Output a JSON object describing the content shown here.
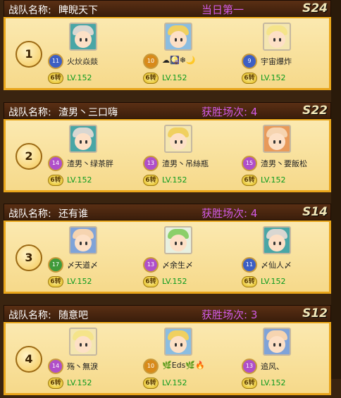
{
  "header_label": "战队名称:",
  "teams": [
    {
      "rank": "1",
      "name": "睥睨天下",
      "stat": "当日第一",
      "server": "S24",
      "members": [
        {
          "name": "火炏焱燚",
          "badge": "11",
          "badge_color": "#3d5fc4",
          "coin": "6转",
          "level": "LV.152",
          "hair": "#d9d7d2",
          "bg": "#49a6a6"
        },
        {
          "name": "☁🎑❄🌙",
          "badge": "10",
          "badge_color": "#d88a1a",
          "coin": "6转",
          "level": "LV.152",
          "hair": "#f0d060",
          "bg": "#8bbde0"
        },
        {
          "name": "宇宙爆炸",
          "badge": "9",
          "badge_color": "#3d5fc4",
          "coin": "6转",
          "level": "LV.152",
          "hair": "#f5e48a",
          "bg": "#f4e6b0"
        }
      ]
    },
    {
      "rank": "2",
      "name": "渣男丶三口嗨",
      "stat": "获胜场次: 4",
      "server": "S22",
      "members": [
        {
          "name": "渣男丶绿茶胖",
          "badge": "14",
          "badge_color": "#b04fc9",
          "coin": "6转",
          "level": "LV.152",
          "hair": "#d9d7d2",
          "bg": "#49a6a6"
        },
        {
          "name": "渣男丶吊絲瓶",
          "badge": "13",
          "badge_color": "#b04fc9",
          "coin": "6转",
          "level": "LV.152",
          "hair": "#f0d060",
          "bg": "#f4e6b0"
        },
        {
          "name": "渣男丶要飯松",
          "badge": "15",
          "badge_color": "#b04fc9",
          "coin": "6转",
          "level": "LV.152",
          "hair": "#f6d4b0",
          "bg": "#e89a5a"
        }
      ]
    },
    {
      "rank": "3",
      "name": "还有谁",
      "stat": "获胜场次: 4",
      "server": "S14",
      "members": [
        {
          "name": "〆天道〆",
          "badge": "17",
          "badge_color": "#3f9a3a",
          "coin": "6转",
          "level": "LV.152",
          "hair": "#f6d4b0",
          "bg": "#7fa3d8"
        },
        {
          "name": "〆余生〆",
          "badge": "13",
          "badge_color": "#b04fc9",
          "coin": "6转",
          "level": "LV.152",
          "hair": "#8bcf6a",
          "bg": "#e8f0e0"
        },
        {
          "name": "〆仙人〆",
          "badge": "11",
          "badge_color": "#3d5fc4",
          "coin": "6转",
          "level": "LV.152",
          "hair": "#d9d7d2",
          "bg": "#49a6a6"
        }
      ]
    },
    {
      "rank": "4",
      "name": "随意吧",
      "stat": "获胜场次: 3",
      "server": "S12",
      "members": [
        {
          "name": "殇丶無淚",
          "badge": "14",
          "badge_color": "#b04fc9",
          "coin": "6转",
          "level": "LV.152",
          "hair": "#f5e48a",
          "bg": "#f4e6b0"
        },
        {
          "name": "🌿Eds🌿🔥",
          "badge": "10",
          "badge_color": "#d88a1a",
          "coin": "6转",
          "level": "LV.152",
          "hair": "#f0d060",
          "bg": "#8bbde0"
        },
        {
          "name": "追风、",
          "badge": "13",
          "badge_color": "#b04fc9",
          "coin": "6转",
          "level": "LV.152",
          "hair": "#f6d4b0",
          "bg": "#7fa3d8"
        }
      ]
    }
  ]
}
